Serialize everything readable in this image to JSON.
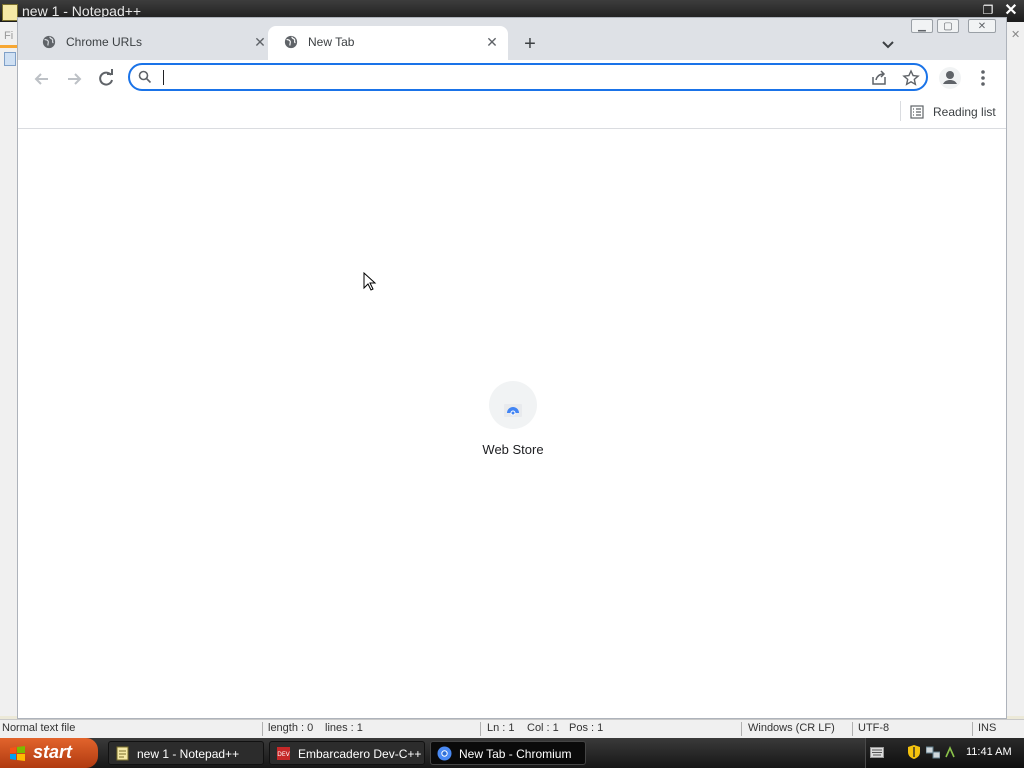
{
  "notepad": {
    "title": "new 1 - Notepad++",
    "menu_hint": "Fi",
    "statusbar": {
      "file_type": "Normal text file",
      "length": "length : 0",
      "lines": "lines : 1",
      "ln": "Ln : 1",
      "col": "Col : 1",
      "pos": "Pos : 1",
      "eol": "Windows (CR LF)",
      "encoding": "UTF-8",
      "mode": "INS"
    }
  },
  "browser": {
    "tabs": [
      {
        "title": "Chrome URLs",
        "icon": "globe-icon",
        "active": false
      },
      {
        "title": "New Tab",
        "icon": "globe-icon",
        "active": true
      }
    ],
    "omnibox": {
      "value": "",
      "placeholder": ""
    },
    "bookmarks_bar": {
      "reading_list_label": "Reading list"
    },
    "new_tab_page": {
      "shortcuts": [
        {
          "label": "Web Store",
          "icon": "web-store-icon"
        }
      ]
    },
    "colors": {
      "accent": "#1a73e8",
      "tabstrip": "#dee1e6"
    }
  },
  "taskbar": {
    "start_label": "start",
    "items": [
      {
        "label": "new 1 - Notepad++",
        "icon": "notepad-icon",
        "active": false
      },
      {
        "label": "Embarcadero Dev-C++",
        "icon": "devcpp-icon",
        "active": false
      },
      {
        "label": "New Tab - Chromium",
        "icon": "chromium-icon",
        "active": true
      }
    ],
    "clock": "11:41 AM"
  }
}
